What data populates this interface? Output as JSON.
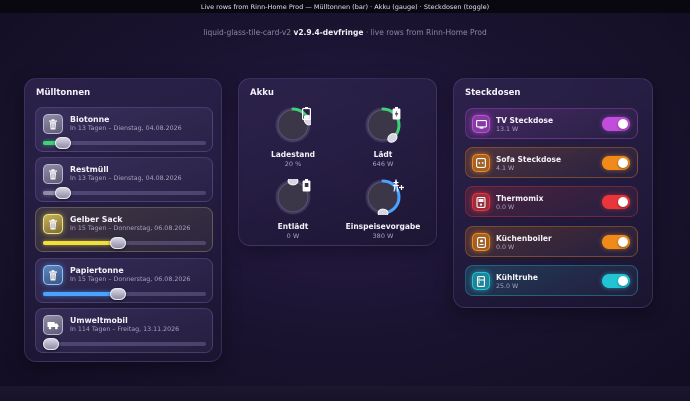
{
  "header": {
    "topbar_text": "Live rows from Rinn-Home Prod — Mülltonnen (bar) · Akku (gauge) · Steckdosen (toggle)",
    "subtitle_prefix": "liquid-glass-tile-card-v2",
    "subtitle_version": "v2.9.4-devfringe",
    "subtitle_suffix": "· live rows from Rinn-Home Prod"
  },
  "muelltonnen": {
    "title": "Mülltonnen",
    "items": [
      {
        "name": "Biotonne",
        "sub": "In 13 Tagen – Dienstag, 04.08.2026",
        "progress": 0.12,
        "fill_color": "#3fd17a",
        "icon": "trash-icon",
        "theme": "grey"
      },
      {
        "name": "Restmüll",
        "sub": "In 13 Tagen – Dienstag, 04.08.2026",
        "progress": 0.12,
        "fill_color": "#8f8ca6",
        "icon": "trash-icon",
        "theme": "grey"
      },
      {
        "name": "Gelber Sack",
        "sub": "In 15 Tagen – Donnerstag, 06.08.2026",
        "progress": 0.46,
        "fill_color": "#f2df3a",
        "icon": "trash-icon",
        "theme": "yellow"
      },
      {
        "name": "Papiertonne",
        "sub": "In 15 Tagen – Donnerstag, 06.08.2026",
        "progress": 0.46,
        "fill_color": "#4aa3ff",
        "icon": "trash-icon",
        "theme": "blue"
      },
      {
        "name": "Umweltmobil",
        "sub": "In 114 Tagen – Freitag, 13.11.2026",
        "progress": 0.0,
        "fill_color": "#8f8ca6",
        "icon": "truck-icon",
        "theme": "grey"
      }
    ]
  },
  "akku": {
    "title": "Akku",
    "gauges": [
      {
        "label": "Ladestand",
        "value": "20 %",
        "fraction": 0.2,
        "color": "#3fd17a",
        "icon": "battery-low-icon"
      },
      {
        "label": "Lädt",
        "value": "646 W",
        "fraction": 0.4,
        "color": "#3fd17a",
        "icon": "battery-charging-icon"
      },
      {
        "label": "Entlädt",
        "value": "0 W",
        "fraction": 0.0,
        "color": "#8f8ca6",
        "icon": "battery-discharge-icon"
      },
      {
        "label": "Einspeisevorgabe",
        "value": "380 W",
        "fraction": 0.5,
        "color": "#4aa3ff",
        "icon": "grid-feed-icon"
      }
    ]
  },
  "steckdosen": {
    "title": "Steckdosen",
    "items": [
      {
        "name": "TV Steckdose",
        "value": "13.1 W",
        "on": true,
        "color": "#c04ddb",
        "icon": "tv-icon"
      },
      {
        "name": "Sofa Steckdose",
        "value": "4.1 W",
        "on": true,
        "color": "#f08a1a",
        "icon": "socket-icon"
      },
      {
        "name": "Thermomix",
        "value": "0.0 W",
        "on": true,
        "color": "#e8363a",
        "icon": "thermomix-icon"
      },
      {
        "name": "Küchenboiler",
        "value": "0.0 W",
        "on": true,
        "color": "#f08a1a",
        "icon": "boiler-icon"
      },
      {
        "name": "Kühltruhe",
        "value": "25.0 W",
        "on": true,
        "color": "#22c4d4",
        "icon": "fridge-icon"
      }
    ]
  }
}
